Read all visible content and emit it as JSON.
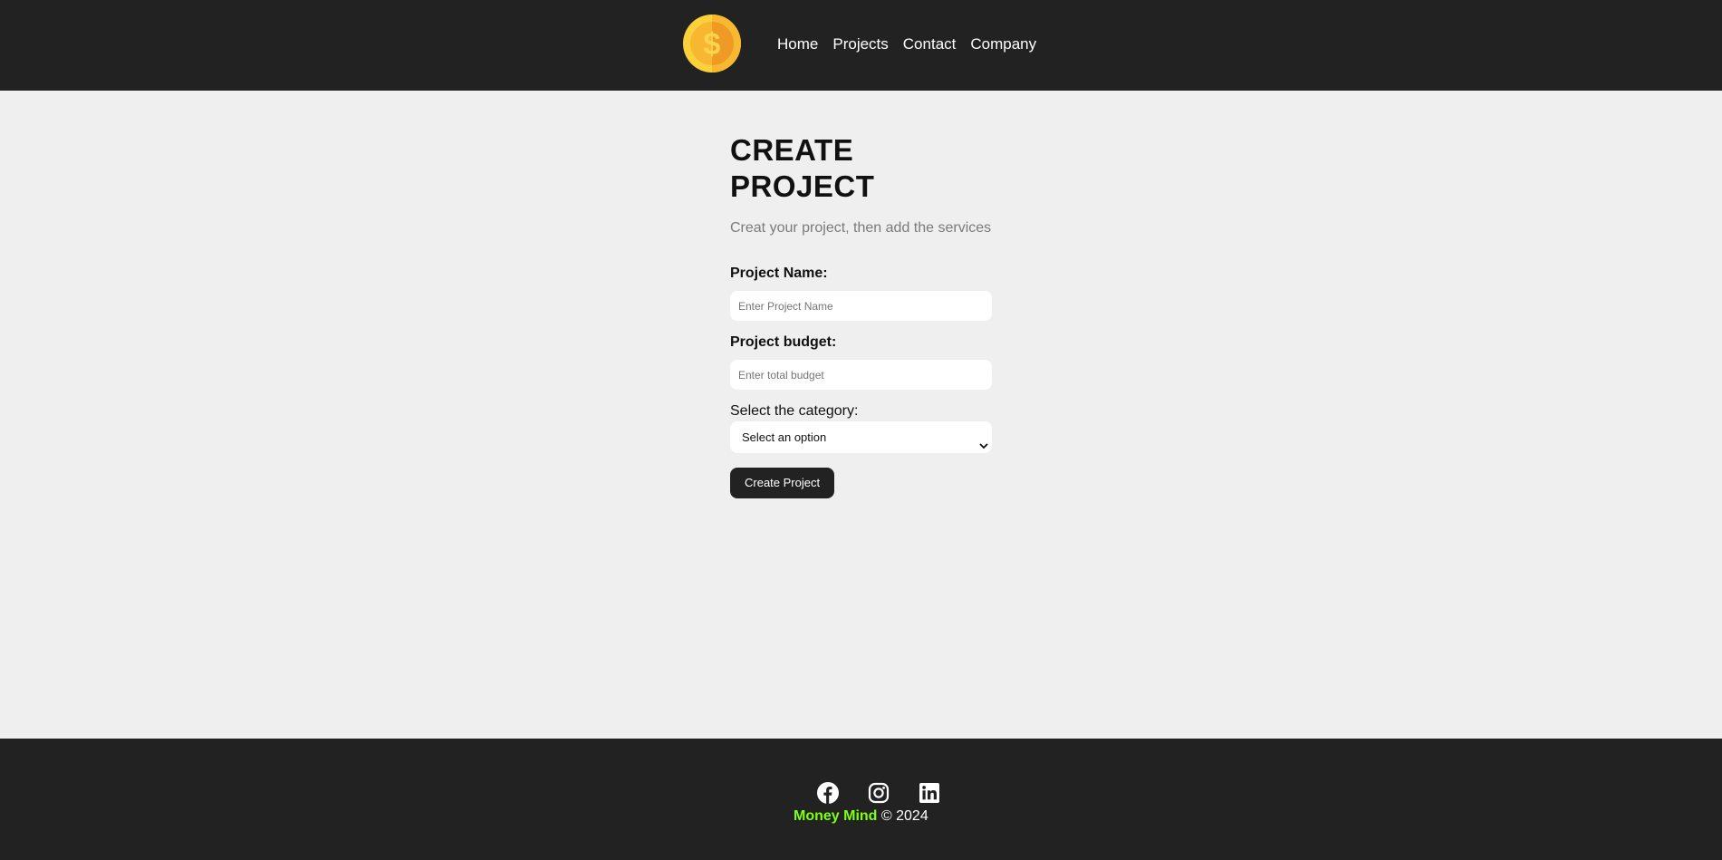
{
  "navbar": {
    "logo_icon": "dollar-coin-icon",
    "links": [
      {
        "label": "Home"
      },
      {
        "label": "Projects"
      },
      {
        "label": "Contact"
      },
      {
        "label": "Company"
      }
    ]
  },
  "form": {
    "title": "CREATE PROJECT",
    "subtitle": "Creat your project, then add the services",
    "name_label": "Project Name:",
    "name_placeholder": "Enter Project Name",
    "budget_label": "Project budget:",
    "budget_placeholder": "Enter total budget",
    "category_label": "Select the category:",
    "category_selected": "Select an option",
    "submit_label": "Create Project"
  },
  "footer": {
    "social_icons": [
      "facebook-icon",
      "instagram-icon",
      "linkedin-icon"
    ],
    "brand": "Money Mind",
    "copyright": "© 2024"
  },
  "colors": {
    "nav_bg": "#222222",
    "page_bg": "#efefef",
    "brand_accent": "#7fff12",
    "coin_outer": "#fbd13b",
    "coin_inner": "#f3a62a"
  }
}
